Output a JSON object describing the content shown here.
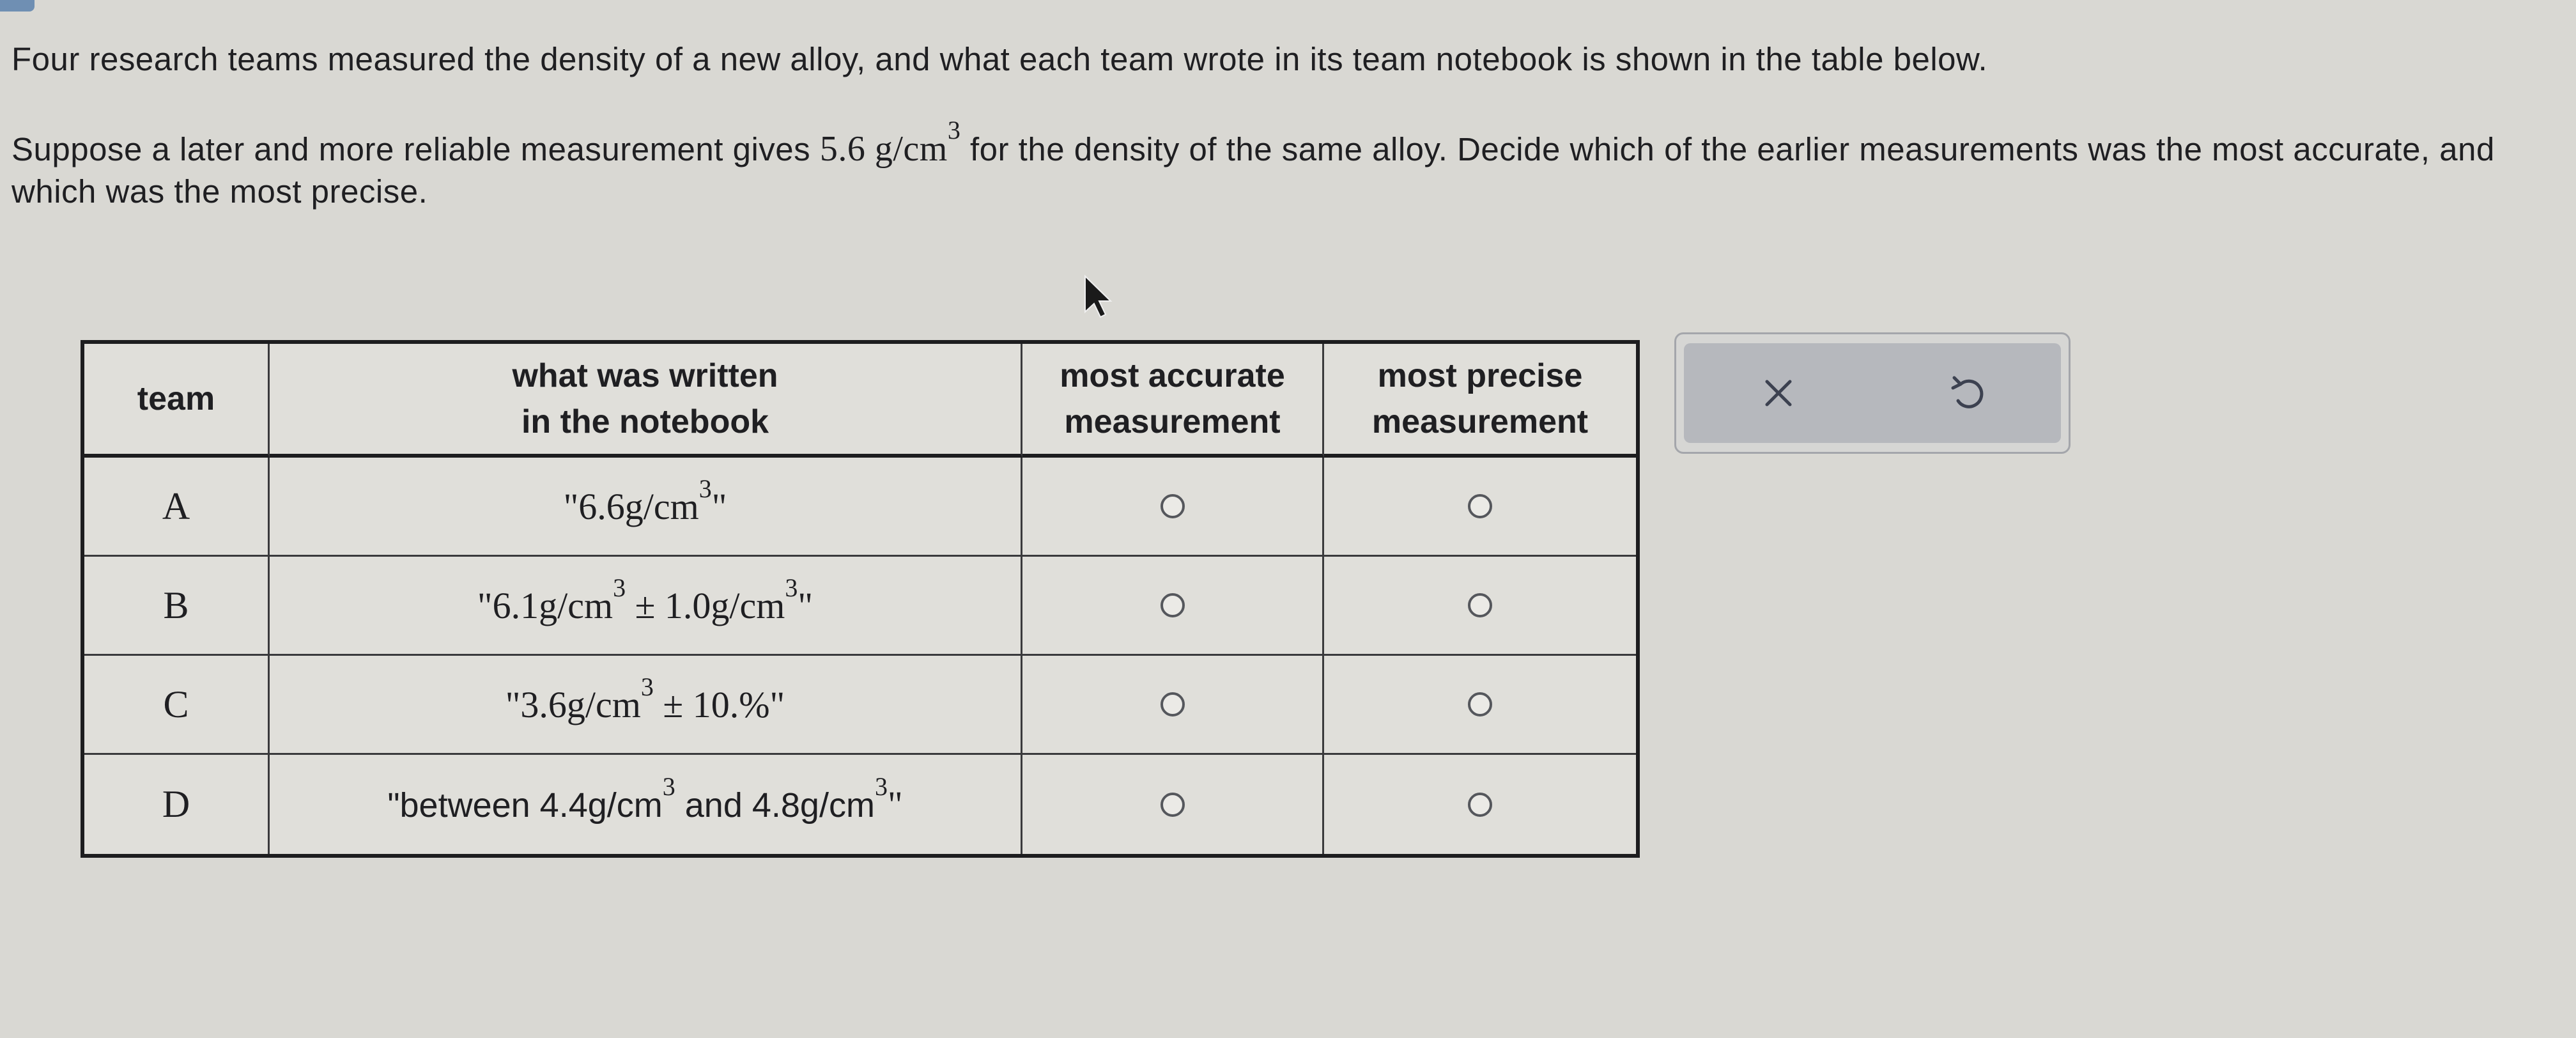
{
  "prompt": {
    "line1": "Four research teams measured the density of a new alloy, and what each team wrote in its team notebook is shown in the table below.",
    "line2_before": "Suppose a later and more reliable measurement gives ",
    "line2_value": "5.6 g/cm",
    "line2_exp": "3",
    "line2_after": " for the density of the same alloy. Decide which of the earlier measurements was the most accurate, and which was the most precise."
  },
  "table": {
    "headers": {
      "team": "team",
      "written": "what was written\nin the notebook",
      "accurate": "most accurate\nmeasurement",
      "precise": "most precise\nmeasurement"
    },
    "rows": [
      {
        "team": "A",
        "parts": [
          "\"6.6g/cm",
          "3",
          "\""
        ]
      },
      {
        "team": "B",
        "parts": [
          "\"6.1g/cm",
          "3",
          " ± 1.0g/cm",
          "3",
          "\""
        ]
      },
      {
        "team": "C",
        "parts": [
          "\"3.6g/cm",
          "3",
          " ± 10.%\""
        ]
      },
      {
        "team": "D",
        "parts": [
          "\"between 4.4g/cm",
          "3",
          " and 4.8g/cm",
          "3",
          "\""
        ]
      }
    ]
  },
  "actions": {
    "clear_icon": "close-icon",
    "undo_icon": "undo-icon"
  }
}
